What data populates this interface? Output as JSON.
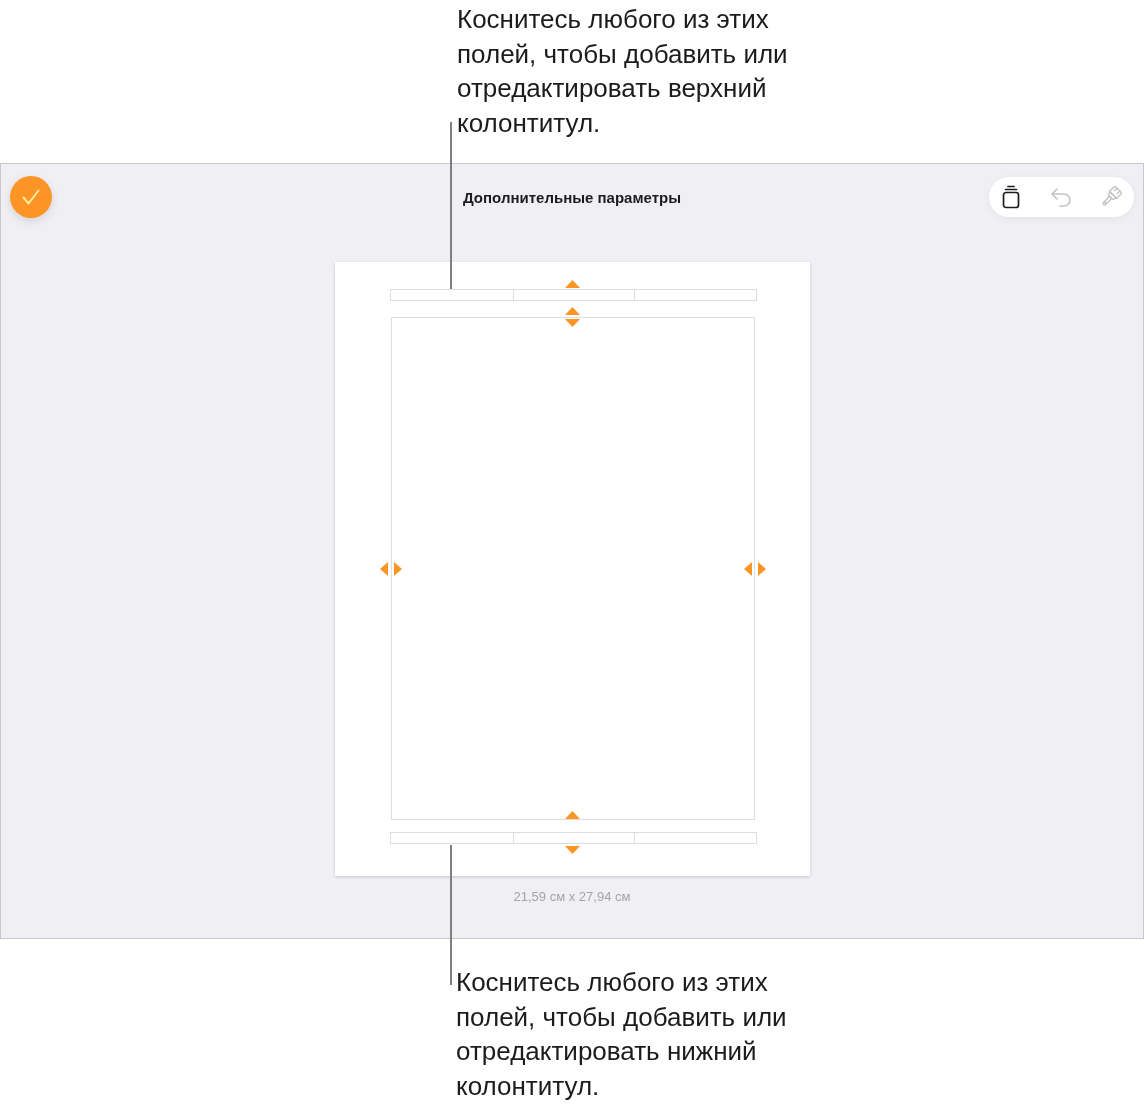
{
  "header_callout": {
    "text": "Коснитесь любого из этих полей, чтобы добавить или отредактировать верхний колонтитул."
  },
  "screen": {
    "title": "Дополнительные параметры",
    "tools": [
      {
        "kind": "duplicate",
        "disabled": false
      },
      {
        "kind": "undo",
        "disabled": true
      },
      {
        "kind": "paintbrush",
        "disabled": true
      }
    ],
    "paper_size": "21,59 см x 27,94 см"
  },
  "footer_callout": {
    "text": "Коснитесь любого из этих полей, чтобы добавить или отредактировать нижний колонтитул."
  }
}
